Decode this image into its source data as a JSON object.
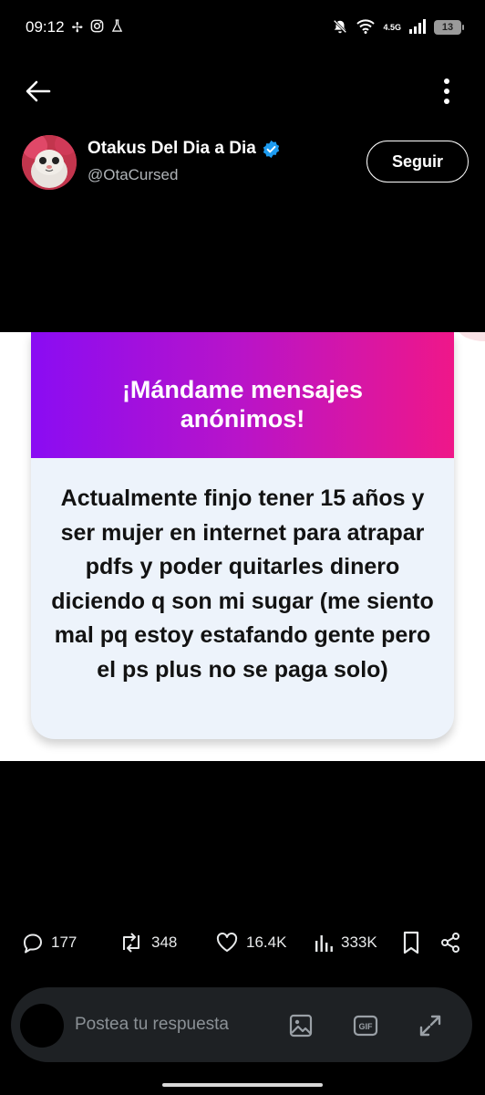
{
  "status_bar": {
    "time": "09:12",
    "network_label": "4.5G",
    "battery": "13"
  },
  "profile": {
    "display_name": "Otakus Del Dia a Dia",
    "handle": "@OtaCursed",
    "follow_label": "Seguir",
    "verified_color": "#1d9bf0"
  },
  "card": {
    "title": "¡Mándame mensajes anónimos!",
    "message": "Actualmente finjo tener 15 años y ser mujer en internet para atrapar pdfs y poder quitarles dinero diciendo q son mi sugar (me siento mal pq estoy estafando gente pero el ps plus no se paga solo)",
    "gradient_start": "#8a0cf3",
    "gradient_end": "#ef1789"
  },
  "actions": {
    "replies": "177",
    "reposts": "348",
    "likes": "16.4K",
    "views": "333K"
  },
  "reply": {
    "placeholder": "Postea tu respuesta"
  },
  "icons": {
    "back": "arrow-left-icon",
    "more": "more-vertical-icon",
    "reply": "comment-icon",
    "repost": "repost-icon",
    "like": "heart-icon",
    "views": "bar-chart-icon",
    "bookmark": "bookmark-icon",
    "share": "share-icon",
    "image": "image-icon",
    "gif": "gif-icon",
    "expand": "expand-icon"
  }
}
